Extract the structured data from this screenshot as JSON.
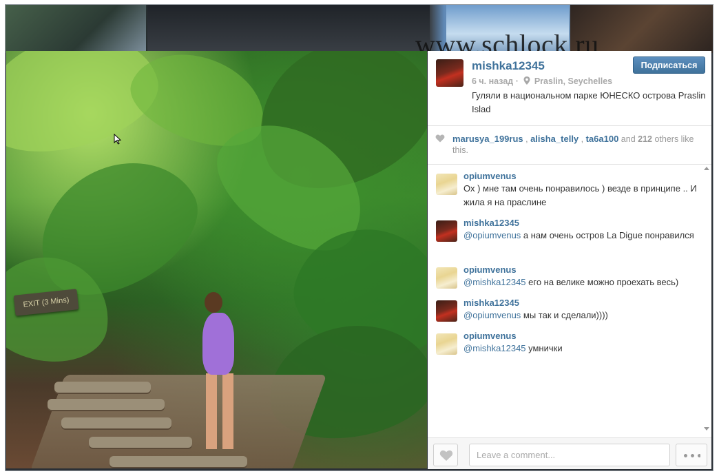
{
  "watermark": "www.schlock.ru",
  "photo": {
    "sign_text": "EXIT (3 Mins)"
  },
  "post": {
    "owner": "mishka12345",
    "time_ago": "6 ч. назад",
    "location": "Praslin, Seychelles",
    "caption": "Гуляли в национальном парке ЮНЕСКО острова Praslin Islad",
    "follow_label": "Подписаться"
  },
  "likes": {
    "user1": "marusya_199rus",
    "sep1": " , ",
    "user2": "alisha_telly",
    "sep2": " , ",
    "user3": "ta6a100",
    "and_text": " and ",
    "count": "212",
    "tail": " others like this."
  },
  "comments": [
    {
      "user": "opiumvenus",
      "mention": "",
      "text": "Ох ) мне там очень понравилось ) везде в принципе .. И жила я на праслине",
      "avatar": "blonde"
    },
    {
      "user": "mishka12345",
      "mention": "@opiumvenus",
      "text": " а нам очень остров La Digue понравился",
      "avatar": "dark"
    },
    {
      "user": "opiumvenus",
      "mention": "@mishka12345",
      "text": " его на велике можно проехать весь)",
      "avatar": "blonde"
    },
    {
      "user": "mishka12345",
      "mention": "@opiumvenus",
      "text": " мы так и сделали))))",
      "avatar": "dark"
    },
    {
      "user": "opiumvenus",
      "mention": "@mishka12345",
      "text": " умнички",
      "avatar": "blonde"
    }
  ],
  "footer": {
    "comment_placeholder": "Leave a comment..."
  },
  "icons": {
    "heart": "heart-icon",
    "pin": "location-pin-icon",
    "more": "more-options-icon"
  },
  "colors": {
    "link": "#3f729b",
    "follow_button": "#4a7db0"
  }
}
